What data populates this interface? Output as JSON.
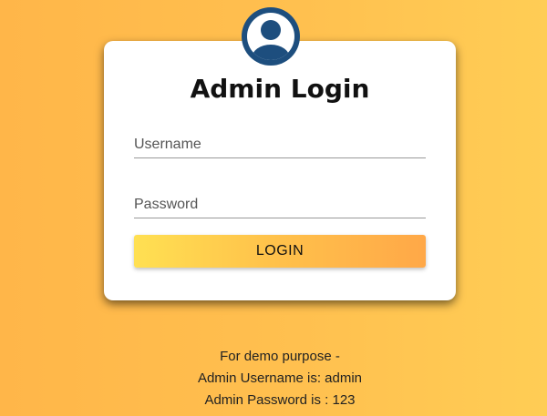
{
  "login": {
    "title": "Admin Login",
    "username_placeholder": "Username",
    "password_placeholder": "Password",
    "button_label": "LOGIN"
  },
  "demo_info": {
    "line1": "For demo purpose -",
    "line2": "Admin Username is: admin",
    "line3": "Admin Password is : 123"
  },
  "colors": {
    "avatar": "#1d4e7e",
    "background_start": "#ffb649",
    "background_end": "#ffcd55",
    "button_start": "#ffe052",
    "button_end": "#ffa848"
  },
  "icons": {
    "avatar": "user-avatar-icon"
  }
}
